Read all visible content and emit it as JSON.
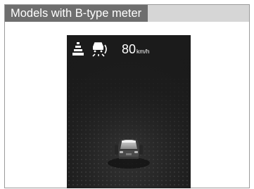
{
  "caption": {
    "text": "Models with B-type meter"
  },
  "display": {
    "speed": {
      "value": "80",
      "unit": "km/h"
    },
    "icons": [
      "lane-keeping-icon",
      "adaptive-cruise-icon",
      "lead-vehicle-icon"
    ]
  },
  "colors": {
    "caption_tab": "#6e6e6e",
    "caption_band": "#d6d6d6",
    "display_background": "#1b1b1b",
    "indicator": "#ffffff"
  }
}
